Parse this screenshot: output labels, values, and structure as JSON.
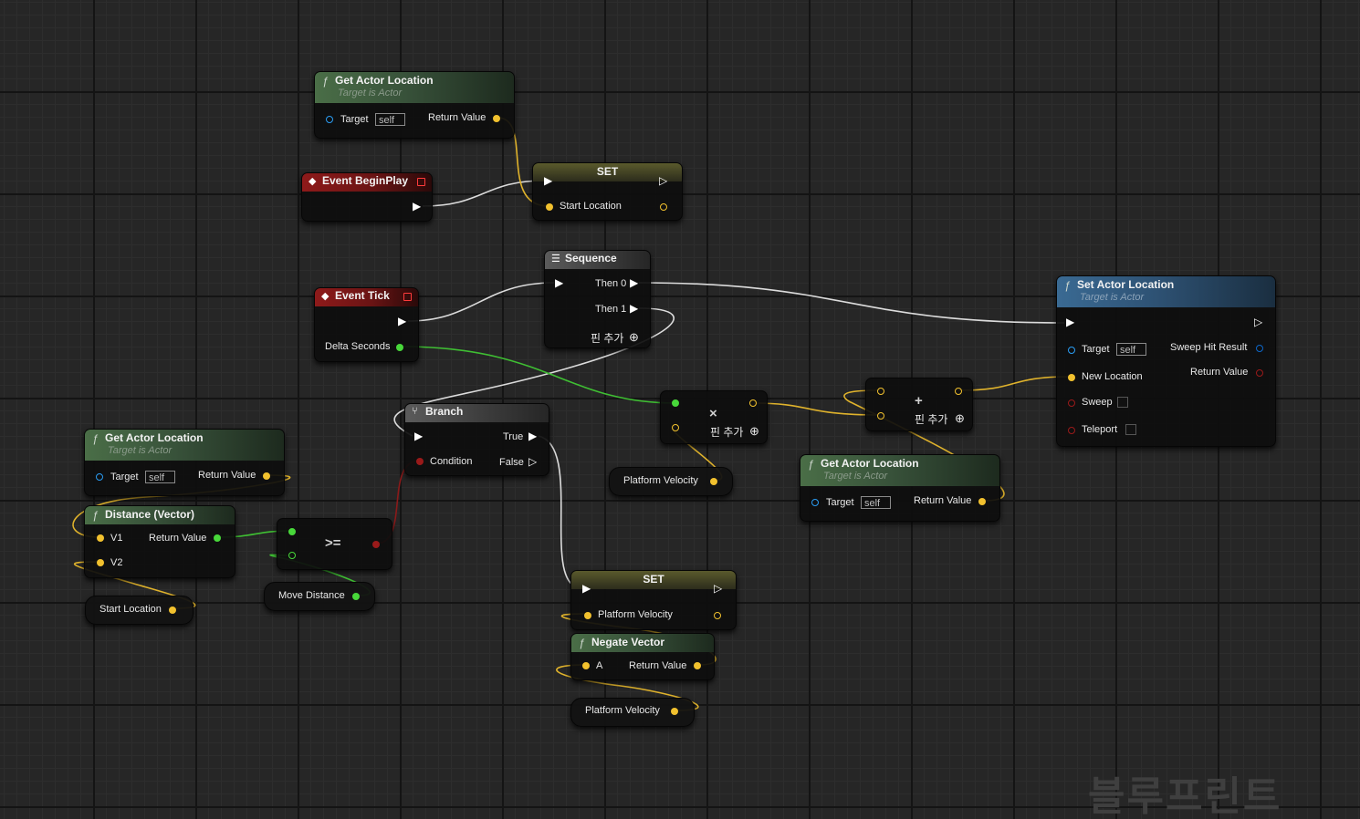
{
  "colors": {
    "exec": "#ffffff",
    "vector": "#f2c12e",
    "float": "#48d83a",
    "boolean": "#9a1a1a",
    "object": "#2a9df4",
    "struct": "#0d67c9",
    "event_header": "#8e1a1a",
    "function_header": "#4a6e47",
    "target_function_header": "#3a6a93"
  },
  "nodes": {
    "get_loc_1": {
      "title": "Get Actor Location",
      "subtitle": "Target is Actor",
      "target_label": "Target",
      "target_value": "self",
      "return_label": "Return Value",
      "icon": "function-icon"
    },
    "begin_play": {
      "title": "Event BeginPlay",
      "icon": "event-icon"
    },
    "set_start": {
      "title": "SET",
      "var_label": "Start Location"
    },
    "sequence": {
      "title": "Sequence",
      "then0": "Then 0",
      "then1": "Then 1",
      "add_pin": "핀 추가",
      "icon": "sequence-icon"
    },
    "event_tick": {
      "title": "Event Tick",
      "delta_label": "Delta Seconds",
      "icon": "event-icon"
    },
    "set_actor_location": {
      "title": "Set Actor Location",
      "subtitle": "Target is Actor",
      "target_label": "Target",
      "target_value": "self",
      "new_location": "New Location",
      "sweep": "Sweep",
      "teleport": "Teleport",
      "sweep_hit": "Sweep Hit Result",
      "return_label": "Return Value",
      "icon": "function-icon"
    },
    "multiply": {
      "symbol": "×",
      "add_pin": "핀 추가"
    },
    "add": {
      "symbol": "+",
      "add_pin": "핀 추가"
    },
    "platform_velocity_1": {
      "label": "Platform Velocity"
    },
    "get_loc_3": {
      "title": "Get Actor Location",
      "subtitle": "Target is Actor",
      "target_label": "Target",
      "target_value": "self",
      "return_label": "Return Value",
      "icon": "function-icon"
    },
    "branch": {
      "title": "Branch",
      "true_label": "True",
      "false_label": "False",
      "condition": "Condition",
      "icon": "branch-icon"
    },
    "get_loc_2": {
      "title": "Get Actor Location",
      "subtitle": "Target is Actor",
      "target_label": "Target",
      "target_value": "self",
      "return_label": "Return Value",
      "icon": "function-icon"
    },
    "distance": {
      "title": "Distance (Vector)",
      "v1": "V1",
      "v2": "V2",
      "return_label": "Return Value",
      "icon": "function-icon"
    },
    "compare": {
      "symbol": ">="
    },
    "start_location": {
      "label": "Start Location"
    },
    "move_distance": {
      "label": "Move Distance"
    },
    "set_velocity": {
      "title": "SET",
      "var_label": "Platform Velocity"
    },
    "negate": {
      "title": "Negate Vector",
      "a_label": "A",
      "return_label": "Return Value",
      "icon": "function-icon"
    },
    "platform_velocity_2": {
      "label": "Platform Velocity"
    }
  },
  "watermark": "블루프린트"
}
